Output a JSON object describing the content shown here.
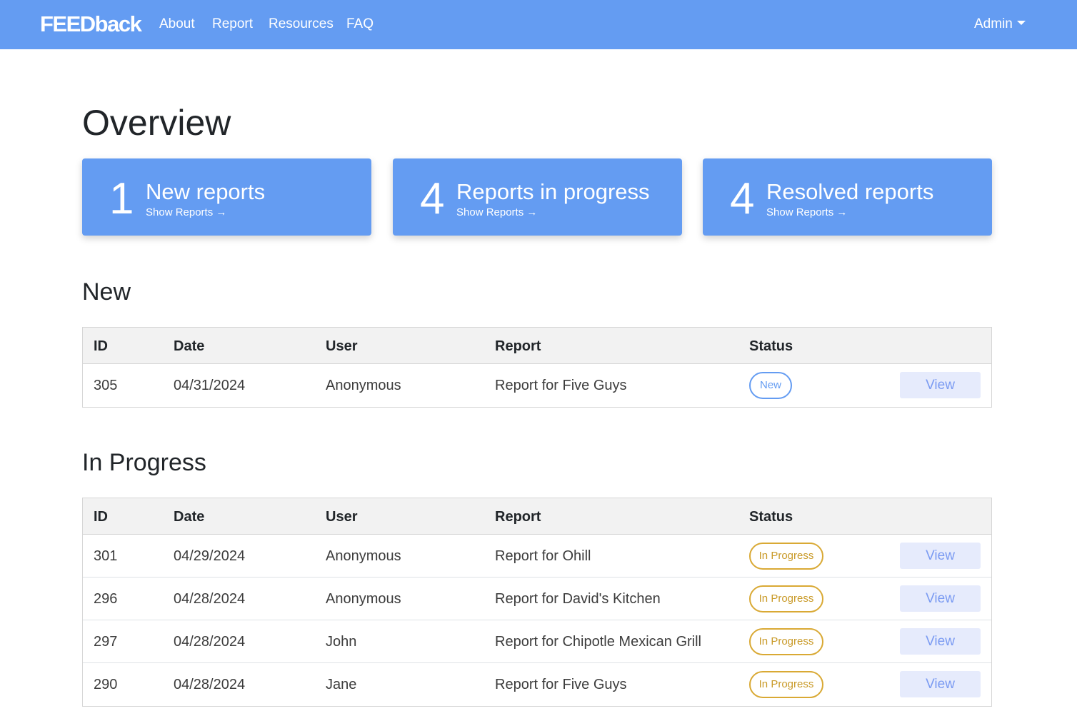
{
  "nav": {
    "brand": "FEEDback",
    "links": [
      "About",
      "Report",
      "Resources",
      "FAQ"
    ],
    "admin_label": "Admin"
  },
  "page_title": "Overview",
  "cards": [
    {
      "count": "1",
      "title": "New reports",
      "link": "Show Reports →"
    },
    {
      "count": "4",
      "title": "Reports in progress",
      "link": "Show Reports →"
    },
    {
      "count": "4",
      "title": "Resolved reports",
      "link": "Show Reports →"
    }
  ],
  "columns": {
    "id": "ID",
    "date": "Date",
    "user": "User",
    "report": "Report",
    "status": "Status"
  },
  "view_label": "View",
  "sections": {
    "new": {
      "title": "New",
      "rows": [
        {
          "id": "305",
          "date": "04/31/2024",
          "user": "Anonymous",
          "report": "Report for Five Guys",
          "status": "New"
        }
      ]
    },
    "in_progress": {
      "title": "In Progress",
      "rows": [
        {
          "id": "301",
          "date": "04/29/2024",
          "user": "Anonymous",
          "report": "Report for Ohill",
          "status": "In Progress"
        },
        {
          "id": "296",
          "date": "04/28/2024",
          "user": "Anonymous",
          "report": "Report for David's Kitchen",
          "status": "In Progress"
        },
        {
          "id": "297",
          "date": "04/28/2024",
          "user": "John",
          "report": "Report for Chipotle Mexican Grill",
          "status": "In Progress"
        },
        {
          "id": "290",
          "date": "04/28/2024",
          "user": "Jane",
          "report": "Report for Five Guys",
          "status": "In Progress"
        }
      ]
    }
  },
  "colors": {
    "primary": "#649cf2",
    "new_badge": "#649cf2",
    "progress_badge": "#d9a934",
    "view_button_bg": "#e6ebfc"
  }
}
